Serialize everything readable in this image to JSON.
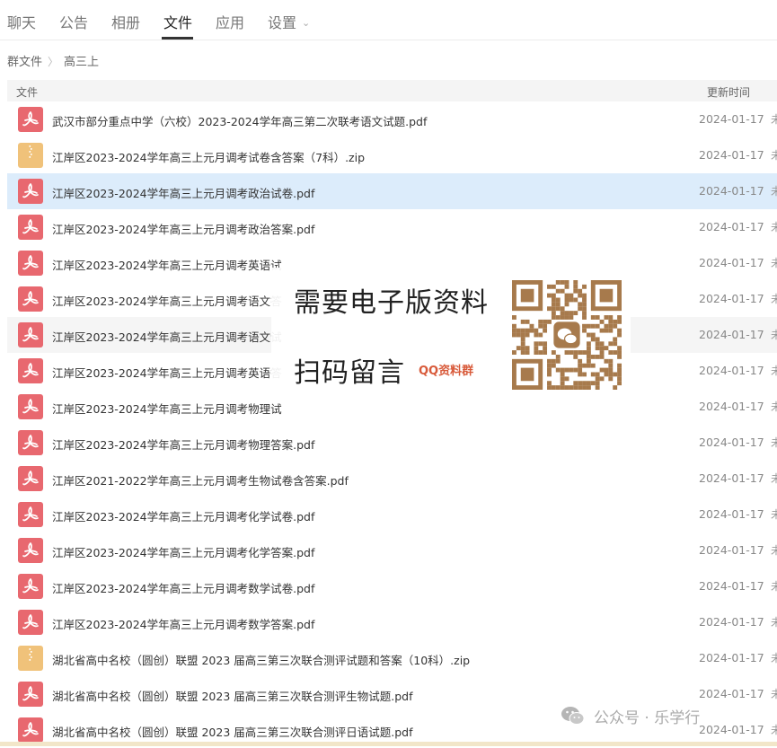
{
  "tabs": [
    {
      "label": "聊天"
    },
    {
      "label": "公告"
    },
    {
      "label": "相册"
    },
    {
      "label": "文件"
    },
    {
      "label": "应用"
    },
    {
      "label": "设置"
    }
  ],
  "breadcrumb": {
    "root": "群文件",
    "sep": "〉",
    "current": "高三上"
  },
  "table": {
    "col_name": "文件",
    "col_date": "更新时间"
  },
  "files": [
    {
      "name": "武汉市部分重点中学（六校）2023-2024学年高三第二次联考语文试题.pdf",
      "type": "pdf",
      "date": "2024-01-17",
      "more": "未"
    },
    {
      "name": "江岸区2023-2024学年高三上元月调考试卷含答案（7科）.zip",
      "type": "zip",
      "date": "2024-01-17",
      "more": "未"
    },
    {
      "name": "江岸区2023-2024学年高三上元月调考政治试卷.pdf",
      "type": "pdf",
      "date": "2024-01-17",
      "more": "未"
    },
    {
      "name": "江岸区2023-2024学年高三上元月调考政治答案.pdf",
      "type": "pdf",
      "date": "2024-01-17",
      "more": "未"
    },
    {
      "name": "江岸区2023-2024学年高三上元月调考英语试",
      "type": "pdf",
      "date": "2024-01-17",
      "more": "未"
    },
    {
      "name": "江岸区2023-2024学年高三上元月调考语文答",
      "type": "pdf",
      "date": "2024-01-17",
      "more": "未"
    },
    {
      "name": "江岸区2023-2024学年高三上元月调考语文试",
      "type": "pdf",
      "date": "2024-01-17",
      "more": "未"
    },
    {
      "name": "江岸区2023-2024学年高三上元月调考英语答",
      "type": "pdf",
      "date": "2024-01-17",
      "more": "未"
    },
    {
      "name": "江岸区2023-2024学年高三上元月调考物理试",
      "type": "pdf",
      "date": "2024-01-17",
      "more": "未"
    },
    {
      "name": "江岸区2023-2024学年高三上元月调考物理答案.pdf",
      "type": "pdf",
      "date": "2024-01-17",
      "more": "未"
    },
    {
      "name": "江岸区2021-2022学年高三上元月调考生物试卷含答案.pdf",
      "type": "pdf",
      "date": "2024-01-17",
      "more": "未"
    },
    {
      "name": "江岸区2023-2024学年高三上元月调考化学试卷.pdf",
      "type": "pdf",
      "date": "2024-01-17",
      "more": "未"
    },
    {
      "name": "江岸区2023-2024学年高三上元月调考化学答案.pdf",
      "type": "pdf",
      "date": "2024-01-17",
      "more": "未"
    },
    {
      "name": "江岸区2023-2024学年高三上元月调考数学试卷.pdf",
      "type": "pdf",
      "date": "2024-01-17",
      "more": "未"
    },
    {
      "name": "江岸区2023-2024学年高三上元月调考数学答案.pdf",
      "type": "pdf",
      "date": "2024-01-17",
      "more": "未"
    },
    {
      "name": "湖北省高中名校（圆创）联盟 2023 届高三第三次联合测评试题和答案（10科）.zip",
      "type": "zip",
      "date": "2024-01-17",
      "more": "未"
    },
    {
      "name": "湖北省高中名校（圆创）联盟 2023 届高三第三次联合测评生物试题.pdf",
      "type": "pdf",
      "date": "2024-01-17",
      "more": "未"
    },
    {
      "name": "湖北省高中名校（圆创）联盟 2023 届高三第三次联合测评日语试题.pdf",
      "type": "pdf",
      "date": "2024-01-17",
      "more": "未"
    }
  ],
  "promo": {
    "line1": "需要电子版资料",
    "line2": "扫码留言",
    "tag": "QQ资料群"
  },
  "watermark": {
    "text": "公众号 · 乐学行"
  },
  "colors": {
    "pdf": "#e8686f",
    "zip": "#f0c27a",
    "selected_row": "#dcecfb",
    "qr": "#a77a4c"
  }
}
